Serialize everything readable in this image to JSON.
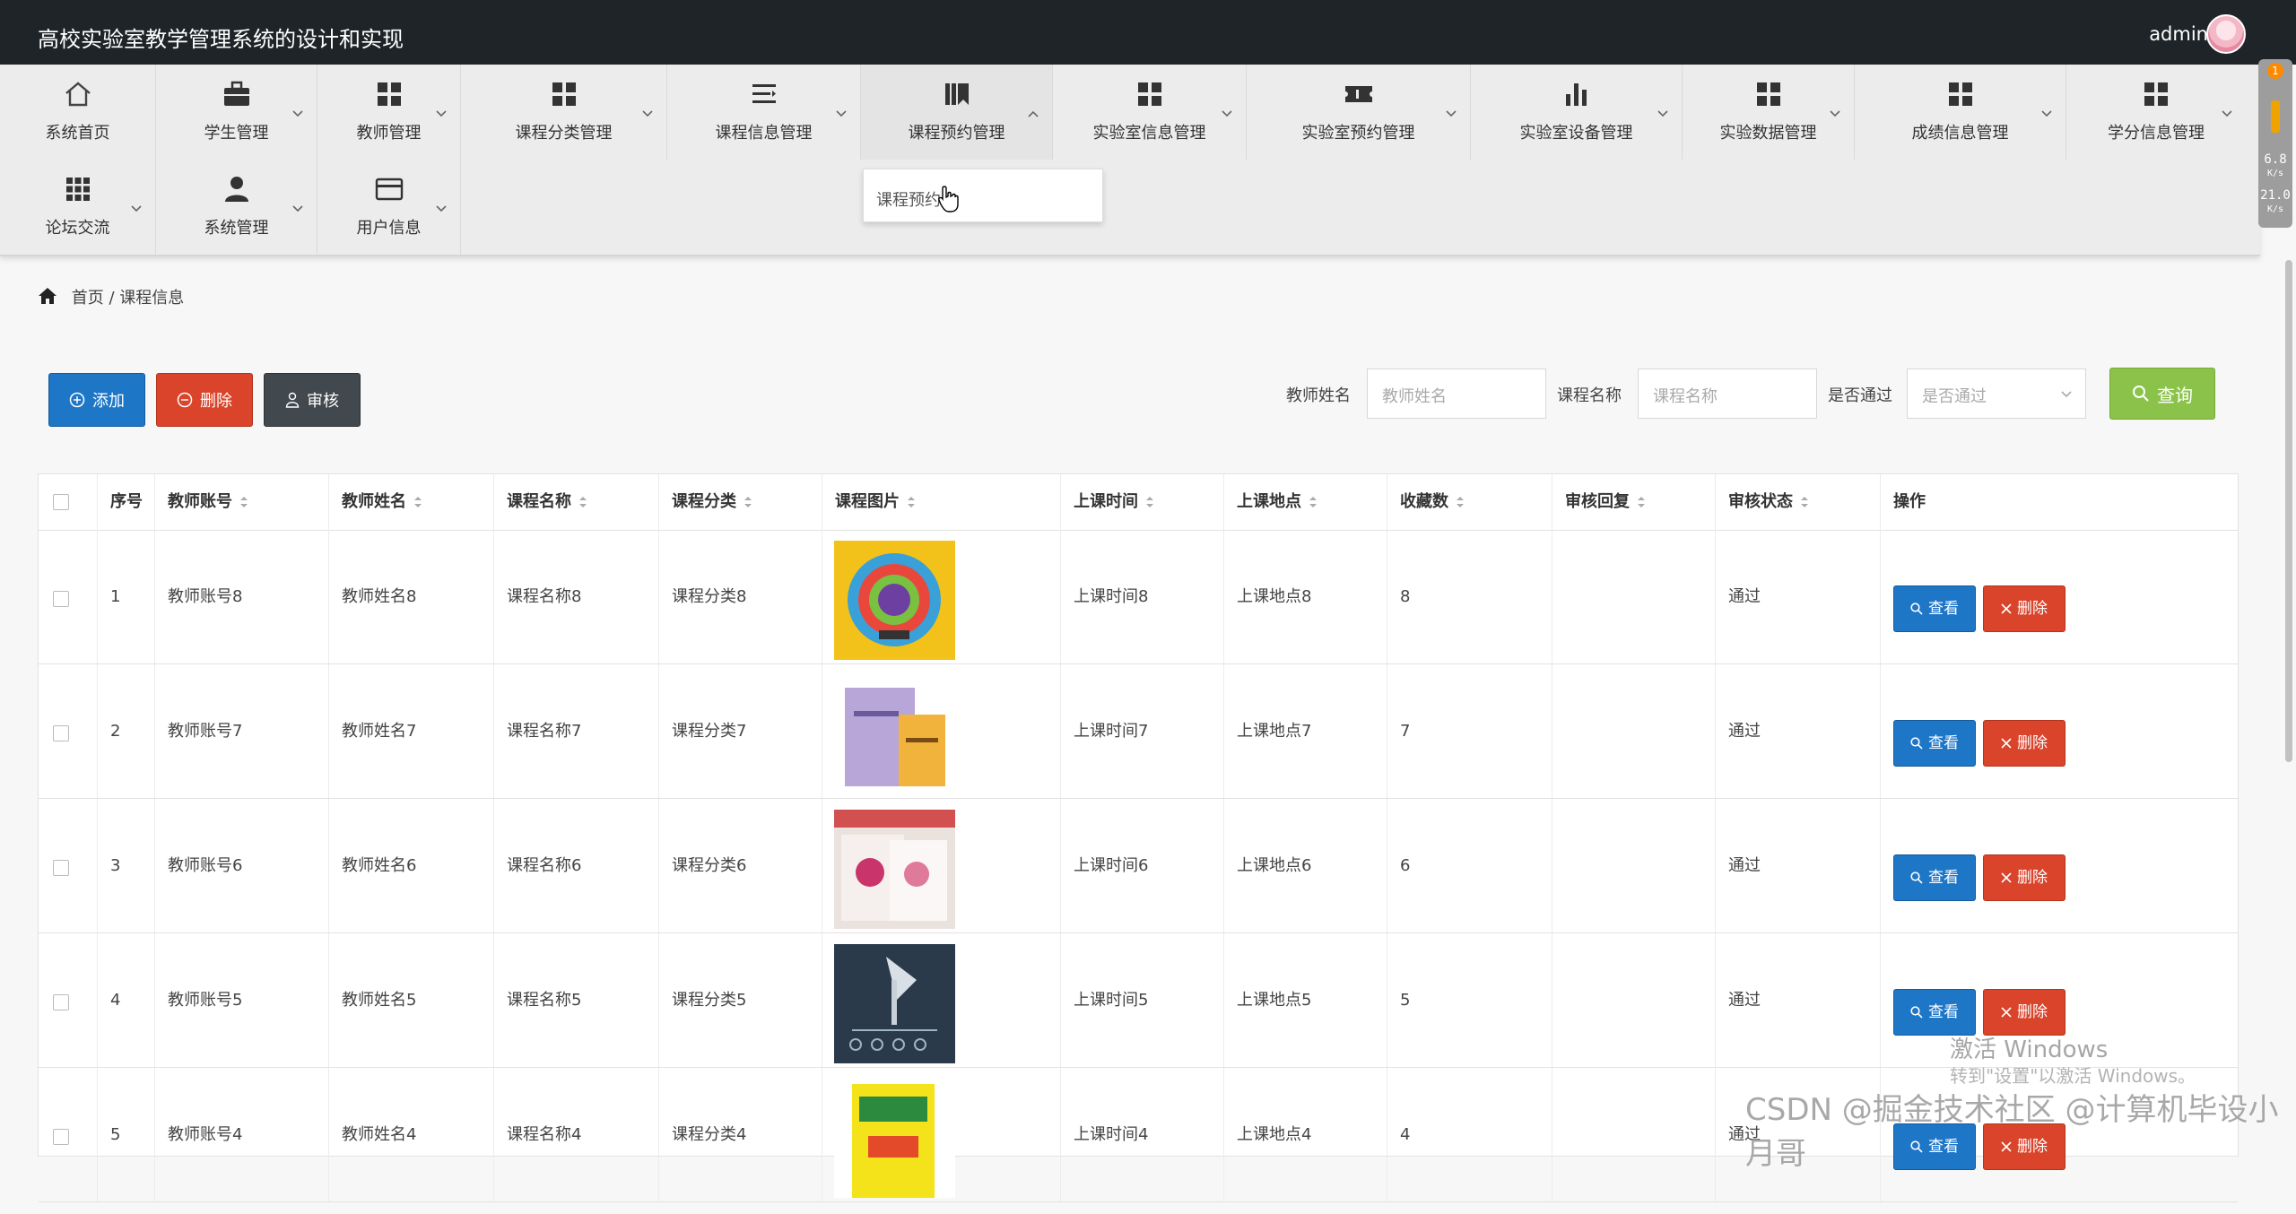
{
  "app": {
    "title": "高校实验室教学管理系统的设计和实现",
    "username": "admin"
  },
  "nav": {
    "items": [
      {
        "label": "系统首页",
        "icon": "home-icon"
      },
      {
        "label": "学生管理",
        "icon": "briefcase-icon"
      },
      {
        "label": "教师管理",
        "icon": "grid-icon"
      },
      {
        "label": "课程分类管理",
        "icon": "grid-icon"
      },
      {
        "label": "课程信息管理",
        "icon": "list-icon"
      },
      {
        "label": "课程预约管理",
        "icon": "bookmark-icon"
      },
      {
        "label": "实验室信息管理",
        "icon": "grid-icon"
      },
      {
        "label": "实验室预约管理",
        "icon": "ticket-icon"
      },
      {
        "label": "实验室设备管理",
        "icon": "bar-chart-icon"
      },
      {
        "label": "实验数据管理",
        "icon": "grid-icon"
      },
      {
        "label": "成绩信息管理",
        "icon": "grid-icon"
      },
      {
        "label": "学分信息管理",
        "icon": "grid-icon"
      },
      {
        "label": "论坛交流",
        "icon": "apps-icon"
      },
      {
        "label": "系统管理",
        "icon": "user-icon"
      },
      {
        "label": "用户信息",
        "icon": "card-icon"
      }
    ],
    "dropdown_item": "课程预约"
  },
  "monitor": {
    "badge": "1",
    "up": "6.8",
    "down": "21.0",
    "unit": "K/s"
  },
  "breadcrumb": {
    "home": "首页",
    "sep": " / ",
    "current": "课程信息"
  },
  "toolbar": {
    "add": "添加",
    "delete": "删除",
    "audit": "审核"
  },
  "filters": {
    "teacher_label": "教师姓名",
    "teacher_placeholder": "教师姓名",
    "course_label": "课程名称",
    "course_placeholder": "课程名称",
    "pass_label": "是否通过",
    "pass_placeholder": "是否通过",
    "search": "查询"
  },
  "table": {
    "headers": [
      "序号",
      "教师账号",
      "教师姓名",
      "课程名称",
      "课程分类",
      "课程图片",
      "上课时间",
      "上课地点",
      "收藏数",
      "审核回复",
      "审核状态",
      "操作"
    ],
    "rows": [
      {
        "idx": "1",
        "acct": "教师账号8",
        "name": "教师姓名8",
        "course": "课程名称8",
        "cat": "课程分类8",
        "time": "上课时间8",
        "place": "上课地点8",
        "fav": "8",
        "reply": "",
        "status": "通过"
      },
      {
        "idx": "2",
        "acct": "教师账号7",
        "name": "教师姓名7",
        "course": "课程名称7",
        "cat": "课程分类7",
        "time": "上课时间7",
        "place": "上课地点7",
        "fav": "7",
        "reply": "",
        "status": "通过"
      },
      {
        "idx": "3",
        "acct": "教师账号6",
        "name": "教师姓名6",
        "course": "课程名称6",
        "cat": "课程分类6",
        "time": "上课时间6",
        "place": "上课地点6",
        "fav": "6",
        "reply": "",
        "status": "通过"
      },
      {
        "idx": "4",
        "acct": "教师账号5",
        "name": "教师姓名5",
        "course": "课程名称5",
        "cat": "课程分类5",
        "time": "上课时间5",
        "place": "上课地点5",
        "fav": "5",
        "reply": "",
        "status": "通过"
      },
      {
        "idx": "5",
        "acct": "教师账号4",
        "name": "教师姓名4",
        "course": "课程名称4",
        "cat": "课程分类4",
        "time": "上课时间4",
        "place": "上课地点4",
        "fav": "4",
        "reply": "",
        "status": "通过"
      }
    ],
    "view_label": "查看",
    "delete_label": "删除"
  },
  "watermarks": {
    "windows_title": "激活 Windows",
    "windows_sub": "转到\"设置\"以激活 Windows。",
    "csdn": "CSDN @掘金技术社区 @计算机毕设小月哥"
  },
  "colors": {
    "primary": "#1e76c7",
    "danger": "#d9442b",
    "dark": "#41484e",
    "success": "#8bc34a",
    "header": "#1f2428"
  }
}
